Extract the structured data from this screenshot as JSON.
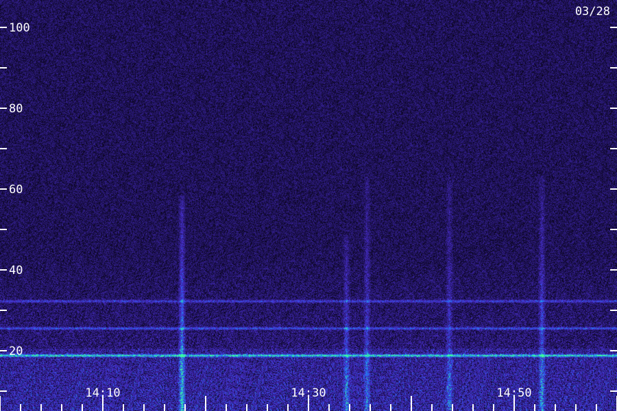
{
  "chart_data": {
    "type": "heatmap",
    "date_label": "03/28",
    "y_ticks": [
      20,
      40,
      60,
      80,
      100
    ],
    "y_minor_ticks": [
      10,
      30,
      50,
      70,
      90
    ],
    "ylim": [
      0,
      105
    ],
    "x_ticks": [
      "14:10",
      "14:30",
      "14:50"
    ],
    "colors": {
      "background": "#1e0f6e",
      "noise_dark": "#080318",
      "noise_bright": "#4a2fd0",
      "signal": "#1a7cff",
      "strong_signal": "#3cff9c"
    },
    "features": [
      {
        "kind": "horizontal_band",
        "freq": 14,
        "strength": 0.9
      },
      {
        "kind": "horizontal_band",
        "freq": 21,
        "strength": 0.5
      },
      {
        "kind": "horizontal_band",
        "freq": 28,
        "strength": 0.45
      },
      {
        "kind": "vertical_burst",
        "time": "14:18",
        "freq_top": 55,
        "strength": 0.9
      },
      {
        "kind": "vertical_burst",
        "time": "14:34",
        "freq_top": 45,
        "strength": 0.6
      },
      {
        "kind": "vertical_burst",
        "time": "14:36",
        "freq_top": 60,
        "strength": 0.55
      },
      {
        "kind": "vertical_burst",
        "time": "14:44",
        "freq_top": 60,
        "strength": 0.5
      },
      {
        "kind": "vertical_burst",
        "time": "14:53",
        "freq_top": 60,
        "strength": 0.65
      }
    ]
  }
}
